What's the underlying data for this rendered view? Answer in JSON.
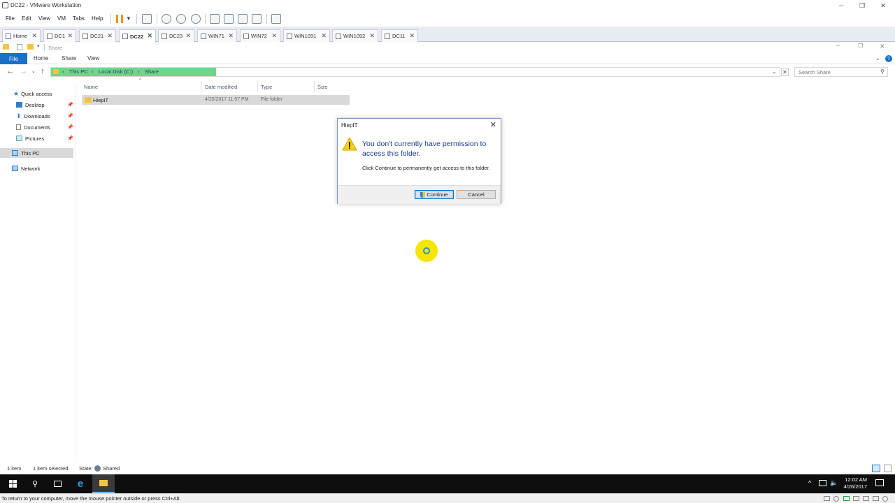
{
  "vmware": {
    "title": "DC22 - VMware Workstation",
    "menu": [
      "File",
      "Edit",
      "View",
      "VM",
      "Tabs",
      "Help"
    ],
    "tabs": [
      {
        "label": "Home",
        "active": false
      },
      {
        "label": "DC1",
        "active": false
      },
      {
        "label": "DC21",
        "active": false
      },
      {
        "label": "DC22",
        "active": true
      },
      {
        "label": "DC23",
        "active": false
      },
      {
        "label": "WIN71",
        "active": false
      },
      {
        "label": "WIN72",
        "active": false
      },
      {
        "label": "WIN1091",
        "active": false
      },
      {
        "label": "WIN1092",
        "active": false
      },
      {
        "label": "DC11",
        "active": false
      }
    ],
    "status_hint": "To return to your computer, move the mouse pointer outside or press Ctrl+Alt."
  },
  "explorer": {
    "quick_access_title": "Share",
    "ribbon": {
      "file": "File",
      "tabs": [
        "Home",
        "Share",
        "View"
      ]
    },
    "breadcrumb": [
      "This PC",
      "Local Disk (C:)",
      "Share"
    ],
    "search_placeholder": "Search Share",
    "nav": {
      "quick_access": "Quick access",
      "desktop": "Desktop",
      "downloads": "Downloads",
      "documents": "Documents",
      "pictures": "Pictures",
      "this_pc": "This PC",
      "network": "Network"
    },
    "columns": [
      "Name",
      "Date modified",
      "Type",
      "Size"
    ],
    "rows": [
      {
        "name": "HiepIT",
        "date": "4/25/2017 11:57 PM",
        "type": "File folder",
        "size": ""
      }
    ],
    "status": {
      "count": "1 item",
      "selected": "1 item selected",
      "state_label": "State:",
      "state_value": "Shared"
    }
  },
  "dialog": {
    "title": "HiepIT",
    "message": "You don't currently have permission to access this folder.",
    "sub": "Click Continue to permanently get access to this folder.",
    "continue_label": "Continue",
    "cancel_label": "Cancel"
  },
  "taskbar": {
    "time": "12:02 AM",
    "date": "4/26/2017"
  },
  "colors": {
    "file_tab": "#1a6fc8",
    "address_highlight": "#6fd58a",
    "cursor_highlight": "#f5e500",
    "dialog_message": "#1c3c8c"
  }
}
